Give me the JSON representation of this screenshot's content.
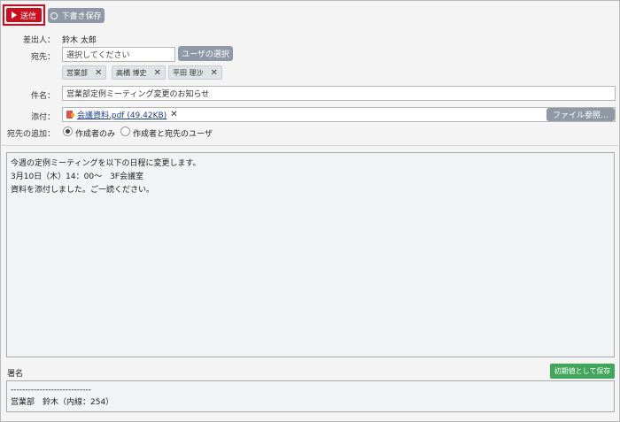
{
  "toolbar": {
    "send_label": "送信",
    "draft_label": "下書き保存"
  },
  "form": {
    "sender_label": "差出人：",
    "sender_value": "鈴木 太郎",
    "to_label": "宛先：",
    "to_placeholder": "選択してください",
    "select_user_label": "ユーザの選択",
    "recipients": [
      "営業部",
      "高橋 博史",
      "平田 理沙"
    ],
    "subject_label": "件名：",
    "subject_value": "営業部定例ミーティング変更のお知らせ",
    "attach_label": "添付：",
    "attachment": "会議資料.pdf (49.42KB)",
    "file_browse_label": "ファイル参照…",
    "add_to_label": "宛先の追加：",
    "add_to_options": [
      "作成者のみ",
      "作成者と宛先のユーザ"
    ],
    "add_to_selected": 0
  },
  "body": {
    "lines": [
      "今週の定例ミーティングを以下の日程に変更します。",
      "",
      "3月10日（木）14：00～　3F会議室",
      "",
      "資料を添付しました。ご一読ください。"
    ]
  },
  "signature": {
    "label": "署名",
    "save_default_label": "初期値として保存",
    "lines": [
      "----------------------------",
      "営業部　鈴木（内線：254）"
    ]
  },
  "colors": {
    "send": "#c8101e",
    "highlight_border": "#e60012",
    "gray_button": "#8e99a5",
    "green_button": "#41a65c"
  }
}
